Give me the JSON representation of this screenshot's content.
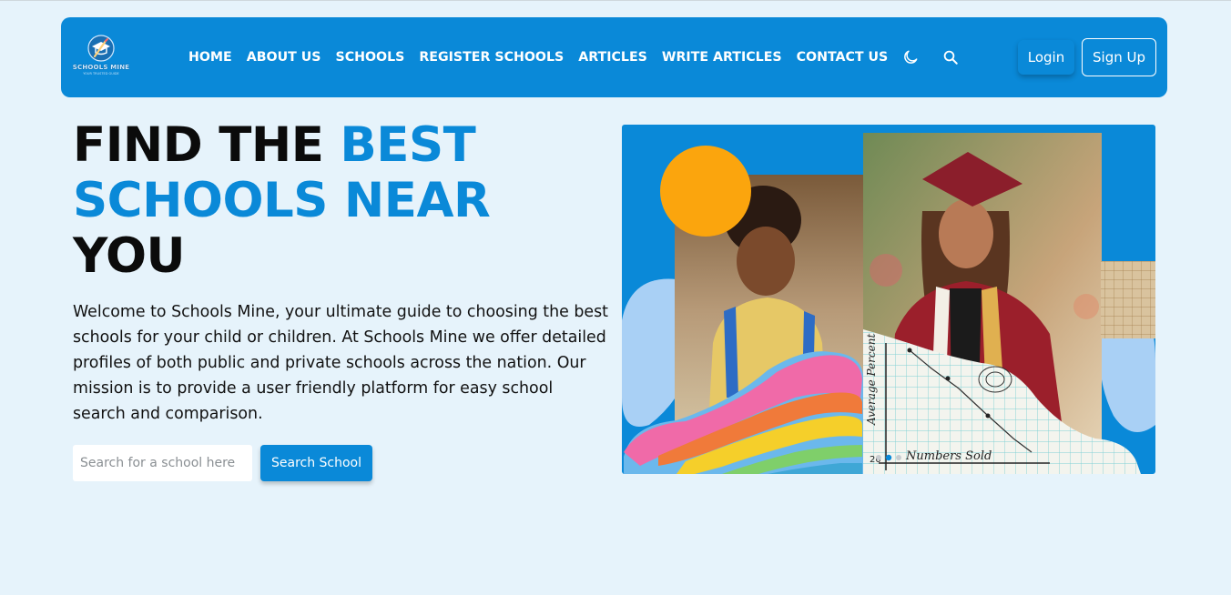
{
  "brand": {
    "name": "SCHOOLS MINE",
    "tagline": "YOUR TRUSTED GUIDE",
    "logo_icon": "graduation-cap-pencil-icon"
  },
  "nav": {
    "links": [
      "HOME",
      "ABOUT US",
      "SCHOOLS",
      "REGISTER SCHOOLS",
      "ARTICLES",
      "WRITE ARTICLES",
      "CONTACT US"
    ],
    "theme_icon": "moon-icon",
    "search_icon": "search-icon",
    "login_label": "Login",
    "signup_label": "Sign Up"
  },
  "hero": {
    "title_part1": "FIND THE ",
    "title_accent": "BEST SCHOOLS NEAR",
    "title_part2": "YOU",
    "description": "Welcome to Schools Mine, your ultimate guide to choosing the best schools for your child or children. At Schools Mine we offer detailed profiles of both public and private schools across the nation. Our mission is to provide a user friendly platform for easy school search and comparison.",
    "search_placeholder": "Search for a school here",
    "search_button": "Search School",
    "image": {
      "chart_ylabel": "Average Percent",
      "chart_xlabel": "Numbers Sold",
      "tick_label": "20"
    }
  },
  "colors": {
    "primary": "#0a89d8",
    "background": "#e6f3fb",
    "text": "#111111",
    "accent_orange": "#fba50d"
  }
}
